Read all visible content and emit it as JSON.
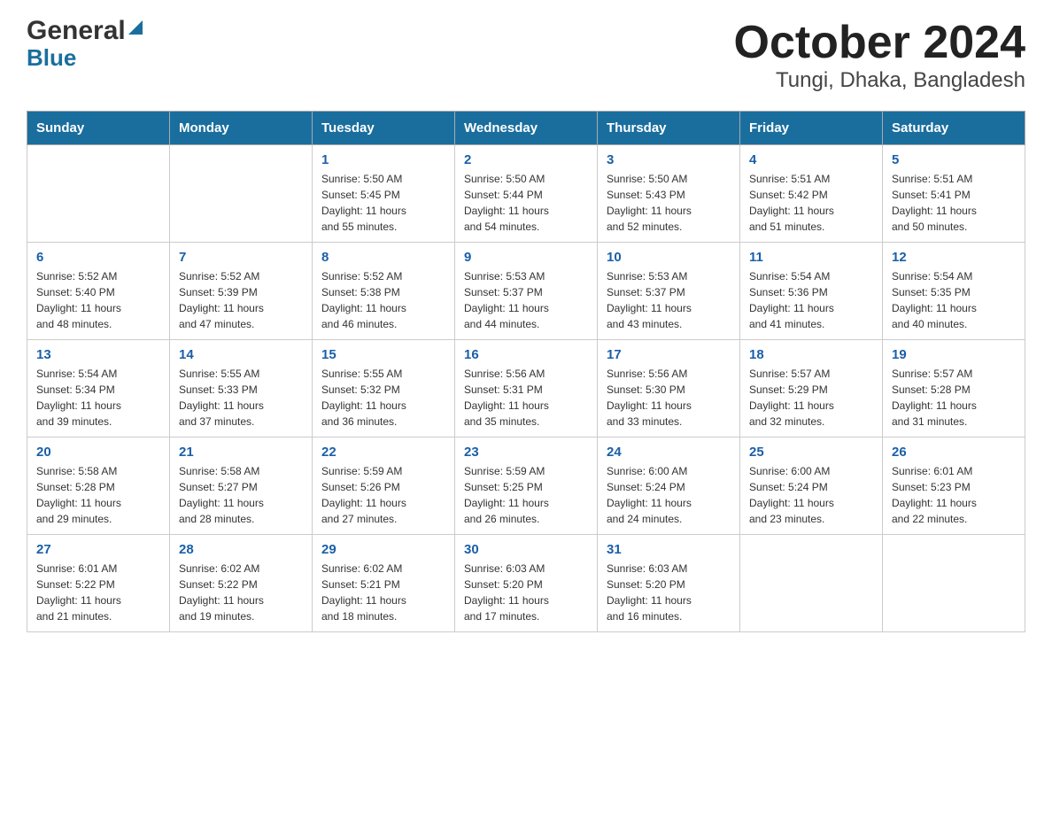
{
  "header": {
    "title": "October 2024",
    "subtitle": "Tungi, Dhaka, Bangladesh",
    "logo_general": "General",
    "logo_blue": "Blue"
  },
  "days_of_week": [
    "Sunday",
    "Monday",
    "Tuesday",
    "Wednesday",
    "Thursday",
    "Friday",
    "Saturday"
  ],
  "weeks": [
    [
      {
        "day": "",
        "info": ""
      },
      {
        "day": "",
        "info": ""
      },
      {
        "day": "1",
        "info": "Sunrise: 5:50 AM\nSunset: 5:45 PM\nDaylight: 11 hours\nand 55 minutes."
      },
      {
        "day": "2",
        "info": "Sunrise: 5:50 AM\nSunset: 5:44 PM\nDaylight: 11 hours\nand 54 minutes."
      },
      {
        "day": "3",
        "info": "Sunrise: 5:50 AM\nSunset: 5:43 PM\nDaylight: 11 hours\nand 52 minutes."
      },
      {
        "day": "4",
        "info": "Sunrise: 5:51 AM\nSunset: 5:42 PM\nDaylight: 11 hours\nand 51 minutes."
      },
      {
        "day": "5",
        "info": "Sunrise: 5:51 AM\nSunset: 5:41 PM\nDaylight: 11 hours\nand 50 minutes."
      }
    ],
    [
      {
        "day": "6",
        "info": "Sunrise: 5:52 AM\nSunset: 5:40 PM\nDaylight: 11 hours\nand 48 minutes."
      },
      {
        "day": "7",
        "info": "Sunrise: 5:52 AM\nSunset: 5:39 PM\nDaylight: 11 hours\nand 47 minutes."
      },
      {
        "day": "8",
        "info": "Sunrise: 5:52 AM\nSunset: 5:38 PM\nDaylight: 11 hours\nand 46 minutes."
      },
      {
        "day": "9",
        "info": "Sunrise: 5:53 AM\nSunset: 5:37 PM\nDaylight: 11 hours\nand 44 minutes."
      },
      {
        "day": "10",
        "info": "Sunrise: 5:53 AM\nSunset: 5:37 PM\nDaylight: 11 hours\nand 43 minutes."
      },
      {
        "day": "11",
        "info": "Sunrise: 5:54 AM\nSunset: 5:36 PM\nDaylight: 11 hours\nand 41 minutes."
      },
      {
        "day": "12",
        "info": "Sunrise: 5:54 AM\nSunset: 5:35 PM\nDaylight: 11 hours\nand 40 minutes."
      }
    ],
    [
      {
        "day": "13",
        "info": "Sunrise: 5:54 AM\nSunset: 5:34 PM\nDaylight: 11 hours\nand 39 minutes."
      },
      {
        "day": "14",
        "info": "Sunrise: 5:55 AM\nSunset: 5:33 PM\nDaylight: 11 hours\nand 37 minutes."
      },
      {
        "day": "15",
        "info": "Sunrise: 5:55 AM\nSunset: 5:32 PM\nDaylight: 11 hours\nand 36 minutes."
      },
      {
        "day": "16",
        "info": "Sunrise: 5:56 AM\nSunset: 5:31 PM\nDaylight: 11 hours\nand 35 minutes."
      },
      {
        "day": "17",
        "info": "Sunrise: 5:56 AM\nSunset: 5:30 PM\nDaylight: 11 hours\nand 33 minutes."
      },
      {
        "day": "18",
        "info": "Sunrise: 5:57 AM\nSunset: 5:29 PM\nDaylight: 11 hours\nand 32 minutes."
      },
      {
        "day": "19",
        "info": "Sunrise: 5:57 AM\nSunset: 5:28 PM\nDaylight: 11 hours\nand 31 minutes."
      }
    ],
    [
      {
        "day": "20",
        "info": "Sunrise: 5:58 AM\nSunset: 5:28 PM\nDaylight: 11 hours\nand 29 minutes."
      },
      {
        "day": "21",
        "info": "Sunrise: 5:58 AM\nSunset: 5:27 PM\nDaylight: 11 hours\nand 28 minutes."
      },
      {
        "day": "22",
        "info": "Sunrise: 5:59 AM\nSunset: 5:26 PM\nDaylight: 11 hours\nand 27 minutes."
      },
      {
        "day": "23",
        "info": "Sunrise: 5:59 AM\nSunset: 5:25 PM\nDaylight: 11 hours\nand 26 minutes."
      },
      {
        "day": "24",
        "info": "Sunrise: 6:00 AM\nSunset: 5:24 PM\nDaylight: 11 hours\nand 24 minutes."
      },
      {
        "day": "25",
        "info": "Sunrise: 6:00 AM\nSunset: 5:24 PM\nDaylight: 11 hours\nand 23 minutes."
      },
      {
        "day": "26",
        "info": "Sunrise: 6:01 AM\nSunset: 5:23 PM\nDaylight: 11 hours\nand 22 minutes."
      }
    ],
    [
      {
        "day": "27",
        "info": "Sunrise: 6:01 AM\nSunset: 5:22 PM\nDaylight: 11 hours\nand 21 minutes."
      },
      {
        "day": "28",
        "info": "Sunrise: 6:02 AM\nSunset: 5:22 PM\nDaylight: 11 hours\nand 19 minutes."
      },
      {
        "day": "29",
        "info": "Sunrise: 6:02 AM\nSunset: 5:21 PM\nDaylight: 11 hours\nand 18 minutes."
      },
      {
        "day": "30",
        "info": "Sunrise: 6:03 AM\nSunset: 5:20 PM\nDaylight: 11 hours\nand 17 minutes."
      },
      {
        "day": "31",
        "info": "Sunrise: 6:03 AM\nSunset: 5:20 PM\nDaylight: 11 hours\nand 16 minutes."
      },
      {
        "day": "",
        "info": ""
      },
      {
        "day": "",
        "info": ""
      }
    ]
  ]
}
